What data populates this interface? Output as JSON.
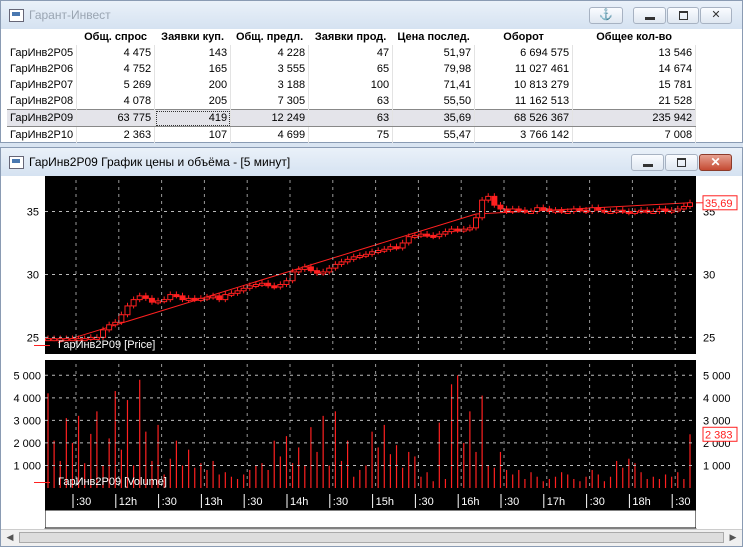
{
  "quotes_window": {
    "title": "Гарант-Инвест",
    "columns": [
      "",
      "Общ. спрос",
      "Заявки куп.",
      "Общ. предл.",
      "Заявки прод.",
      "Цена послед.",
      "Оборот",
      "Общее кол-во"
    ],
    "rows": [
      {
        "name": "ГарИнв2Р05",
        "demand": "4 475",
        "bids": "143",
        "supply": "4 228",
        "asks": "47",
        "last": "51,97",
        "turnover": "6 694 575",
        "qty": "13 546"
      },
      {
        "name": "ГарИнв2Р06",
        "demand": "4 752",
        "bids": "165",
        "supply": "3 555",
        "asks": "65",
        "last": "79,98",
        "turnover": "11 027 461",
        "qty": "14 674"
      },
      {
        "name": "ГарИнв2Р07",
        "demand": "5 269",
        "bids": "200",
        "supply": "3 188",
        "asks": "100",
        "last": "71,41",
        "turnover": "10 813 279",
        "qty": "15 781"
      },
      {
        "name": "ГарИнв2Р08",
        "demand": "4 078",
        "bids": "205",
        "supply": "7 305",
        "asks": "63",
        "last": "55,50",
        "turnover": "11 162 513",
        "qty": "21 528"
      },
      {
        "name": "ГарИнв2Р09",
        "demand": "63 775",
        "bids": "419",
        "supply": "12 249",
        "asks": "63",
        "last": "35,69",
        "turnover": "68 526 367",
        "qty": "235 942"
      },
      {
        "name": "ГарИнв2Р10",
        "demand": "2 363",
        "bids": "107",
        "supply": "4 699",
        "asks": "75",
        "last": "55,47",
        "turnover": "3 766 142",
        "qty": "7 008"
      }
    ],
    "selected_row": 4,
    "buttons": {
      "anchor": "⚓",
      "minimize": "",
      "maximize": "",
      "close": "✕"
    }
  },
  "chart_window": {
    "title": "ГарИнв2Р09 График цены и объёма - [5 минут]",
    "buttons": {
      "minimize": "",
      "maximize": "",
      "close": "✕"
    },
    "price_legend": "ГарИнв2Р09 [Price]",
    "volume_legend": "ГарИнв2Р09 [Volume]",
    "last_price_label": "35,69",
    "last_volume_label": "2 383"
  },
  "chart_data": [
    {
      "type": "line",
      "title": "",
      "ylim": [
        24,
        37.5
      ],
      "yticks": [
        25,
        30,
        35
      ],
      "ytick_labels": [
        "25",
        "30",
        "35"
      ],
      "last_value": 35.69,
      "color": "#ff2020",
      "values": [
        24.9,
        24.9,
        24.9,
        24.9,
        24.9,
        24.9,
        24.9,
        25.0,
        25.0,
        25.6,
        26.0,
        26.2,
        26.8,
        27.5,
        28.0,
        28.3,
        28.1,
        27.8,
        27.9,
        28.0,
        28.4,
        28.3,
        28.0,
        28.1,
        28.0,
        28.1,
        28.2,
        28.3,
        28.0,
        28.4,
        28.5,
        28.7,
        28.9,
        29.1,
        29.2,
        29.3,
        29.1,
        29.0,
        29.2,
        29.5,
        30.2,
        30.4,
        30.6,
        30.3,
        30.1,
        30.2,
        30.5,
        30.8,
        31.0,
        31.2,
        31.4,
        31.5,
        31.6,
        31.8,
        31.9,
        32.0,
        32.2,
        32.1,
        32.5,
        33.0,
        33.1,
        33.2,
        33.1,
        33.0,
        33.2,
        33.4,
        33.6,
        33.5,
        33.6,
        33.7,
        34.5,
        35.9,
        36.2,
        35.5,
        35.2,
        35.0,
        35.2,
        35.1,
        35.0,
        35.0,
        35.3,
        35.2,
        35.0,
        35.1,
        35.0,
        35.0,
        35.2,
        35.1,
        35.0,
        35.3,
        35.1,
        35.0,
        35.0,
        35.1,
        35.0,
        34.9,
        35.0,
        35.1,
        35.0,
        35.0,
        35.2,
        35.0,
        35.1,
        35.2,
        35.4,
        35.69
      ],
      "trendline": {
        "from": 24.9,
        "to": 35.69
      }
    },
    {
      "type": "bar",
      "title": "",
      "ylim": [
        0,
        5500
      ],
      "yticks": [
        1000,
        2000,
        3000,
        4000,
        5000
      ],
      "ytick_labels": [
        "1 000",
        "2 000",
        "3 000",
        "4 000",
        "5 000"
      ],
      "last_value": 2383,
      "color": "#ff2020",
      "values": [
        4200,
        2100,
        1200,
        3100,
        2000,
        3200,
        1100,
        2400,
        3400,
        1000,
        2200,
        4300,
        1700,
        3900,
        1000,
        4800,
        2500,
        1200,
        2800,
        600,
        1300,
        2100,
        1000,
        1700,
        900,
        1100,
        800,
        1200,
        600,
        700,
        500,
        400,
        600,
        800,
        1000,
        1100,
        800,
        2100,
        1400,
        2300,
        1100,
        1800,
        1000,
        2700,
        1600,
        3200,
        1000,
        3400,
        1200,
        2100,
        500,
        800,
        1000,
        2500,
        1800,
        2800,
        1500,
        1900,
        900,
        1600,
        1400,
        500,
        700,
        300,
        2900,
        400,
        4600,
        5000,
        2000,
        3400,
        1600,
        4100,
        1000,
        900,
        1600,
        800,
        600,
        800,
        400,
        700,
        500,
        300,
        400,
        500,
        700,
        600,
        400,
        300,
        500,
        800,
        600,
        300,
        500,
        1200,
        900,
        1300,
        1100,
        700,
        400,
        500,
        400,
        600,
        500,
        700,
        400,
        2383
      ],
      "x_tick_labels": [
        ":30",
        "12h",
        ":30",
        "13h",
        ":30",
        "14h",
        ":30",
        "15h",
        ":30",
        "16h",
        ":30",
        "17h",
        ":30",
        "18h",
        ":30"
      ]
    }
  ]
}
